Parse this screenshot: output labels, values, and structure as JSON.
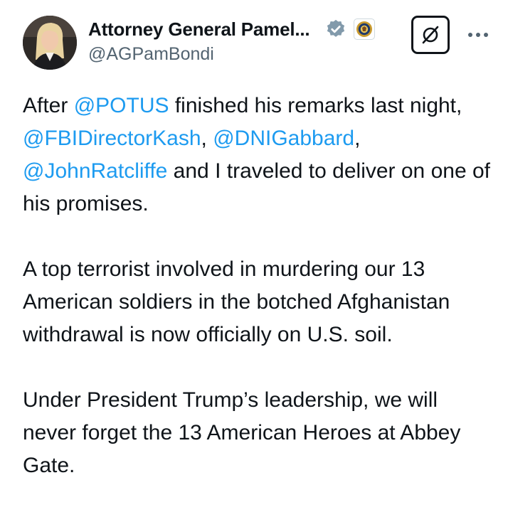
{
  "author": {
    "display_name": "Attorney General Pamel...",
    "handle": "@AGPamBondi",
    "verified_badge": "verified-check-icon",
    "affiliation_badge": "department-of-justice-seal-icon",
    "verified_color": "#829aab"
  },
  "actions": {
    "grok_icon": "grok-icon",
    "more_icon": "more-options-icon"
  },
  "tweet": {
    "p1": {
      "t1": "After ",
      "m1": "@POTUS",
      "t2": " finished his remarks last night, ",
      "m2": "@FBIDirectorKash",
      "t3": ", ",
      "m3": "@DNIGabbard",
      "t4": ", ",
      "m4": "@JohnRatcliffe",
      "t5": " and I traveled to deliver on one of his promises."
    },
    "p2": "A top terrorist involved in murdering our 13 American soldiers in the botched Afghanistan withdrawal is now officially on U.S. soil.",
    "p3": "Under President Trump’s leadership, we will never forget the 13 American Heroes at Abbey Gate."
  },
  "colors": {
    "text": "#0f1419",
    "secondary": "#536471",
    "link": "#1d9bf0"
  }
}
